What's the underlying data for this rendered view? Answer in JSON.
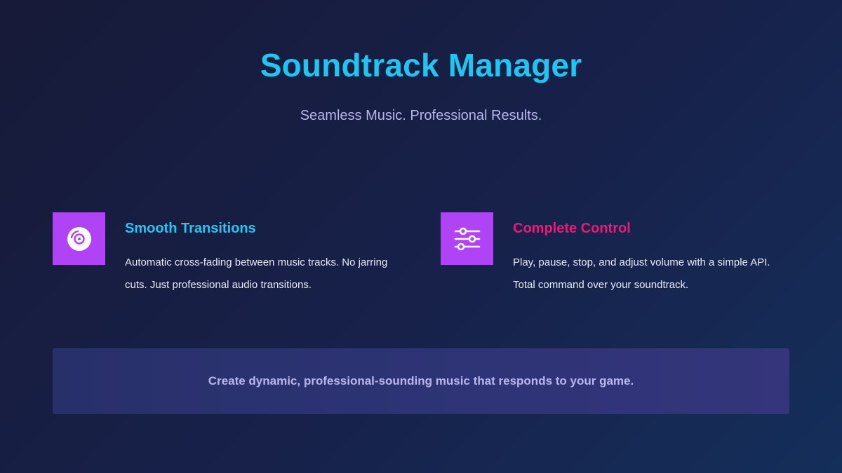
{
  "header": {
    "title": "Soundtrack Manager",
    "subtitle": "Seamless Music. Professional Results."
  },
  "features": [
    {
      "icon": "disc-icon",
      "title": "Smooth Transitions",
      "description": "Automatic cross-fading between music tracks. No jarring cuts. Just professional audio transitions."
    },
    {
      "icon": "sliders-icon",
      "title": "Complete Control",
      "description": "Play, pause, stop, and adjust volume with a simple API. Total command over your soundtrack."
    }
  ],
  "banner": {
    "text": "Create dynamic, professional-sounding music that responds to your game."
  },
  "colors": {
    "title": "#20c5f0",
    "feature_one_title": "#26c6f2",
    "feature_two_title": "#f0177a",
    "icon_background": "#b043f6",
    "subtitle": "#b7b5ec",
    "banner_text": "#b9b6ee"
  }
}
